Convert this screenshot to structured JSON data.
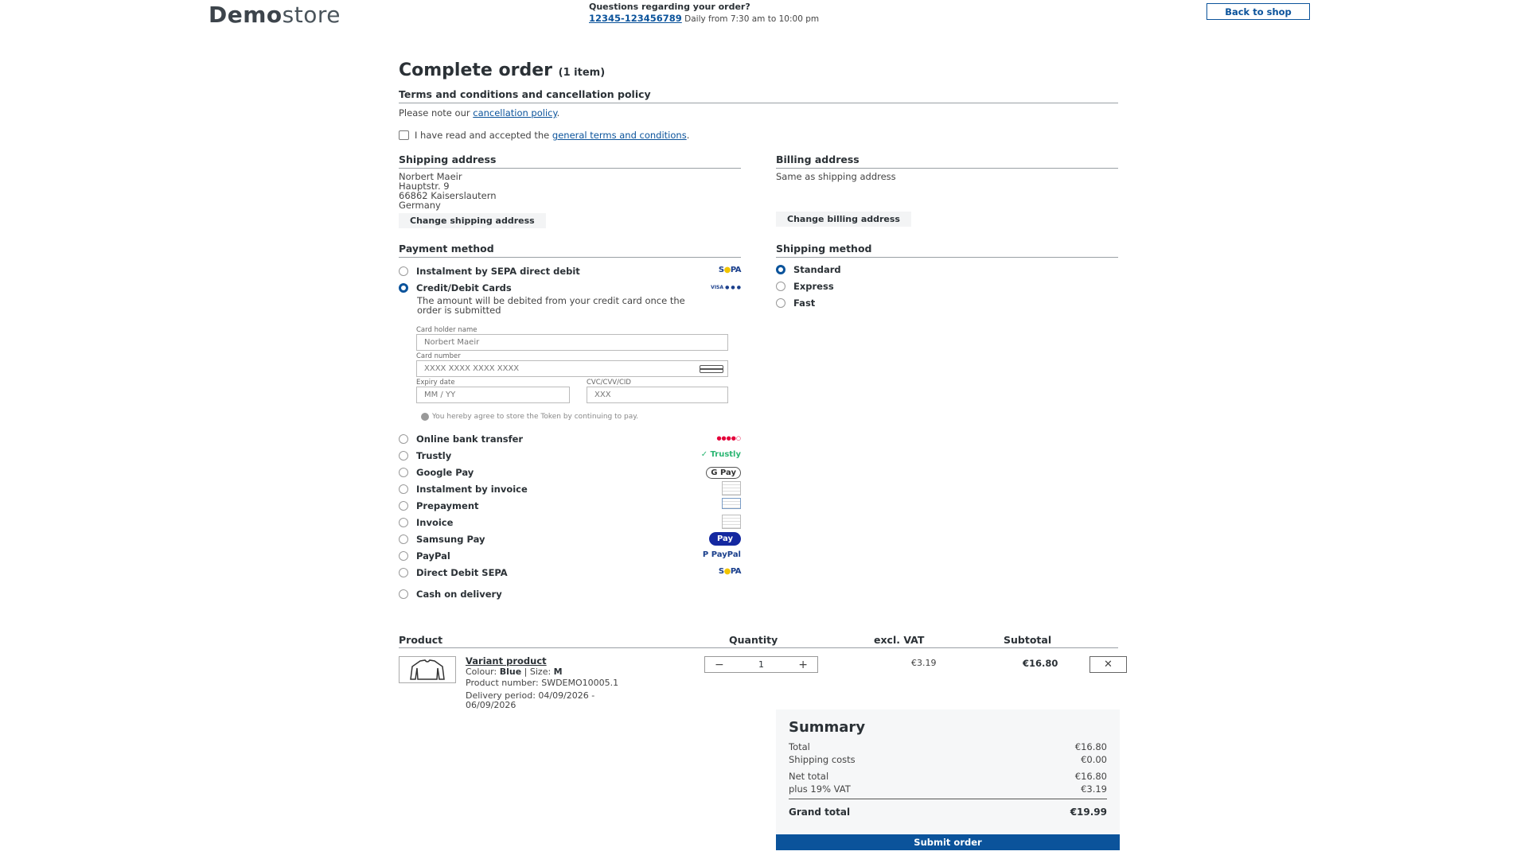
{
  "header": {
    "logo_bold": "Demo",
    "logo_light": "store",
    "question": "Questions regarding your order?",
    "phone": "12345-123456789",
    "hours": "Daily from 7:30 am to 10:00 pm",
    "back_label": "Back to shop"
  },
  "page": {
    "title": "Complete order",
    "item_count": "(1 item)"
  },
  "terms": {
    "heading": "Terms and conditions and cancellation policy",
    "note_prefix": "Please note our",
    "note_link": "cancellation policy",
    "note_suffix": ".",
    "check_prefix": "I have read and accepted the",
    "check_link": "general terms and conditions",
    "check_suffix": "."
  },
  "shipping_address": {
    "heading": "Shipping address",
    "name": "Norbert Maeir",
    "street": "Hauptstr. 9",
    "city": "66862 Kaiserslautern",
    "country": "Germany",
    "change_label": "Change shipping address"
  },
  "billing_address": {
    "heading": "Billing address",
    "text": "Same as shipping address",
    "change_label": "Change billing address"
  },
  "payment": {
    "heading": "Payment method",
    "options": [
      {
        "label": "Instalment by SEPA direct debit",
        "logo": "SEPA"
      },
      {
        "label": "Credit/Debit Cards",
        "logo": "VISA"
      },
      {
        "label": "Online bank transfer",
        "logo": ""
      },
      {
        "label": "Trustly",
        "logo": "Trustly"
      },
      {
        "label": "Google Pay",
        "logo": "G Pay"
      },
      {
        "label": "Instalment by invoice",
        "logo": ""
      },
      {
        "label": "Prepayment",
        "logo": ""
      },
      {
        "label": "Invoice",
        "logo": ""
      },
      {
        "label": "Samsung Pay",
        "logo": "Pay"
      },
      {
        "label": "PayPal",
        "logo": "PayPal"
      },
      {
        "label": "Direct Debit SEPA",
        "logo": "SEPA"
      },
      {
        "label": "Cash on delivery",
        "logo": ""
      }
    ],
    "cc_description": "The amount will be debited from your credit card once the order is submitted",
    "card_holder_label": "Card holder name",
    "card_holder_value": "Norbert Maeir",
    "card_number_label": "Card number",
    "card_number_placeholder": "XXXX XXXX XXXX XXXX",
    "expiry_label": "Expiry date",
    "expiry_placeholder": "MM / YY",
    "cvc_label": "CVC/CVV/CID",
    "cvc_placeholder": "XXX",
    "token_note": "You hereby agree to store the Token by continuing to pay."
  },
  "shipping_method": {
    "heading": "Shipping method",
    "options": [
      "Standard",
      "Express",
      "Fast"
    ]
  },
  "cart": {
    "col_product": "Product",
    "col_quantity": "Quantity",
    "col_vat": "excl. VAT",
    "col_subtotal": "Subtotal",
    "item": {
      "name": "Variant product",
      "colour_label": "Colour:",
      "colour": "Blue",
      "size_label": "Size:",
      "size": "M",
      "number_label": "Product number:",
      "number": "SWDEMO10005.1",
      "delivery": "Delivery period: 04/09/2026 - 06/09/2026",
      "quantity": "1",
      "vat": "€3.19",
      "subtotal": "€16.80"
    }
  },
  "summary": {
    "heading": "Summary",
    "total_label": "Total",
    "total": "€16.80",
    "shipping_label": "Shipping costs",
    "shipping": "€0.00",
    "net_label": "Net total",
    "net": "€16.80",
    "vat_label": "plus 19% VAT",
    "vat": "€3.19",
    "grand_label": "Grand total",
    "grand": "€19.99",
    "submit_label": "Submit order"
  },
  "colors": {
    "accent": "#0b539b",
    "text": "#2b3136"
  }
}
